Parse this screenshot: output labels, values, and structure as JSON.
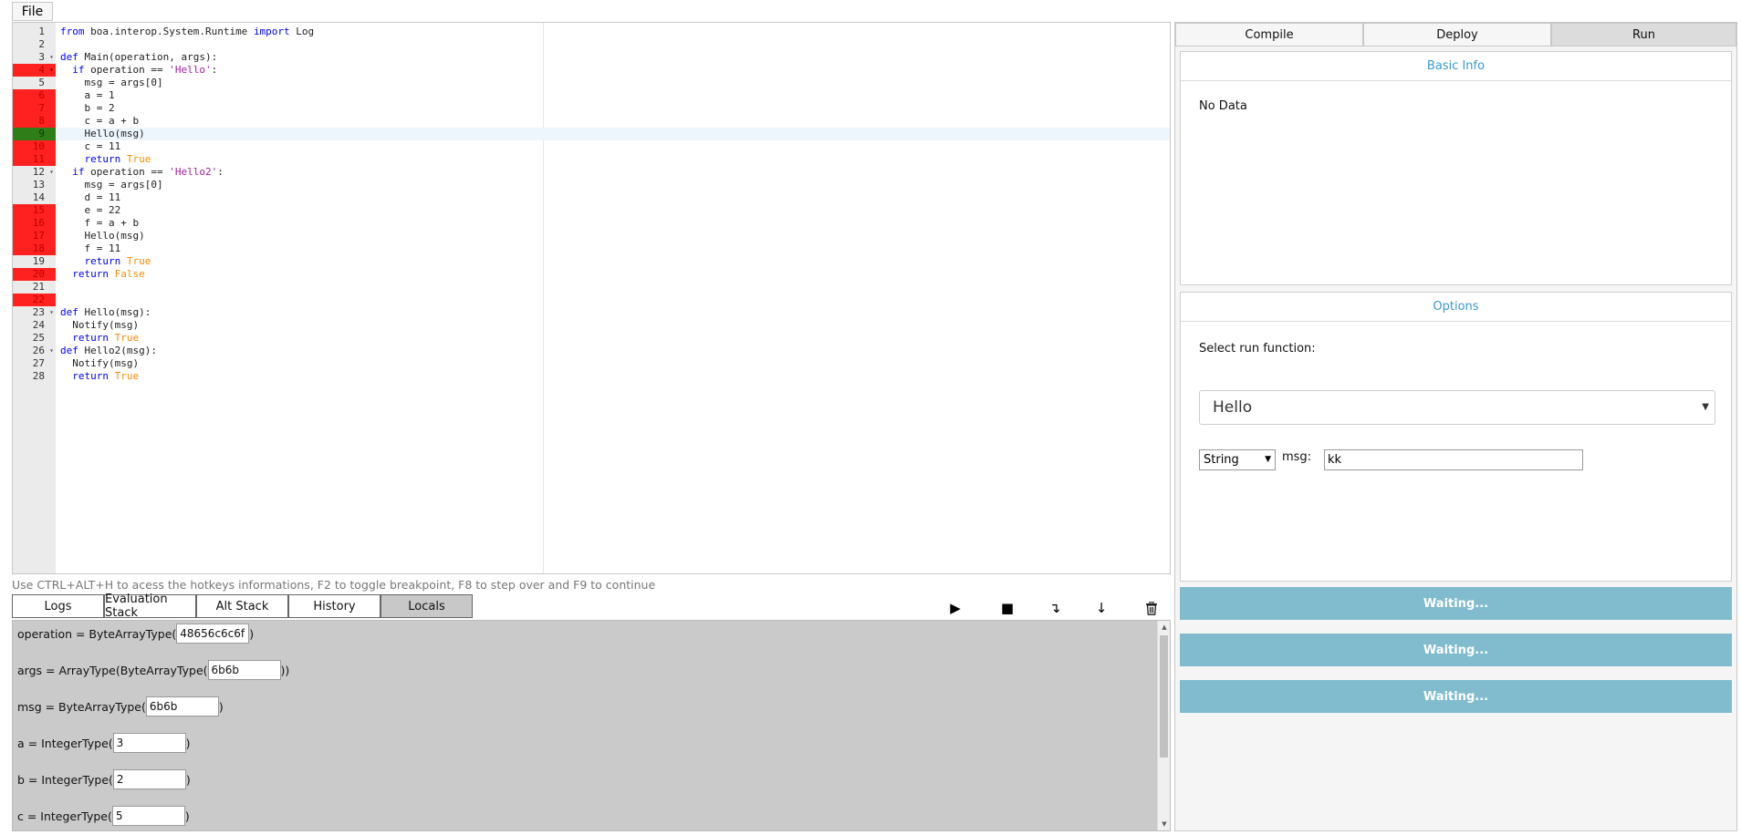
{
  "menu": {
    "file_label": "File"
  },
  "editor": {
    "lines": [
      {
        "n": "1",
        "bp": "none",
        "fold": false,
        "tokens": [
          {
            "t": "from",
            "c": "kw"
          },
          {
            "t": " boa.interop.System.Runtime ",
            "c": ""
          },
          {
            "t": "import",
            "c": "kw"
          },
          {
            "t": " Log",
            "c": ""
          }
        ]
      },
      {
        "n": "2",
        "bp": "none",
        "fold": false,
        "tokens": []
      },
      {
        "n": "3",
        "bp": "none",
        "fold": true,
        "tokens": [
          {
            "t": "def",
            "c": "kw"
          },
          {
            "t": " Main(operation, args):",
            "c": ""
          }
        ]
      },
      {
        "n": "4",
        "bp": "red",
        "fold": true,
        "tokens": [
          {
            "t": "  ",
            "c": ""
          },
          {
            "t": "if",
            "c": "kw"
          },
          {
            "t": " operation == ",
            "c": ""
          },
          {
            "t": "'Hello'",
            "c": "str"
          },
          {
            "t": ":",
            "c": ""
          }
        ]
      },
      {
        "n": "5",
        "bp": "none",
        "fold": false,
        "tokens": [
          {
            "t": "    msg = args[0]",
            "c": ""
          }
        ]
      },
      {
        "n": "6",
        "bp": "red",
        "fold": false,
        "tokens": [
          {
            "t": "    a = 1",
            "c": ""
          }
        ]
      },
      {
        "n": "7",
        "bp": "red",
        "fold": false,
        "tokens": [
          {
            "t": "    b = 2",
            "c": ""
          }
        ]
      },
      {
        "n": "8",
        "bp": "red",
        "fold": false,
        "tokens": [
          {
            "t": "    c = a + b",
            "c": ""
          }
        ]
      },
      {
        "n": "9",
        "bp": "green",
        "fold": false,
        "active": true,
        "tokens": [
          {
            "t": "    Hello(msg)",
            "c": ""
          }
        ]
      },
      {
        "n": "10",
        "bp": "red",
        "fold": false,
        "tokens": [
          {
            "t": "    c = 11",
            "c": ""
          }
        ]
      },
      {
        "n": "11",
        "bp": "red",
        "fold": false,
        "tokens": [
          {
            "t": "    ",
            "c": ""
          },
          {
            "t": "return",
            "c": "kw"
          },
          {
            "t": " ",
            "c": ""
          },
          {
            "t": "True",
            "c": "lit"
          }
        ]
      },
      {
        "n": "12",
        "bp": "none",
        "fold": true,
        "tokens": [
          {
            "t": "  ",
            "c": ""
          },
          {
            "t": "if",
            "c": "kw"
          },
          {
            "t": " operation == ",
            "c": ""
          },
          {
            "t": "'Hello2'",
            "c": "str"
          },
          {
            "t": ":",
            "c": ""
          }
        ]
      },
      {
        "n": "13",
        "bp": "none",
        "fold": false,
        "tokens": [
          {
            "t": "    msg = args[0]",
            "c": ""
          }
        ]
      },
      {
        "n": "14",
        "bp": "none",
        "fold": false,
        "tokens": [
          {
            "t": "    d = 11",
            "c": ""
          }
        ]
      },
      {
        "n": "15",
        "bp": "red",
        "fold": false,
        "tokens": [
          {
            "t": "    e = 22",
            "c": ""
          }
        ]
      },
      {
        "n": "16",
        "bp": "red",
        "fold": false,
        "tokens": [
          {
            "t": "    f = a + b",
            "c": ""
          }
        ]
      },
      {
        "n": "17",
        "bp": "red",
        "fold": false,
        "tokens": [
          {
            "t": "    Hello(msg)",
            "c": ""
          }
        ]
      },
      {
        "n": "18",
        "bp": "red",
        "fold": false,
        "tokens": [
          {
            "t": "    f = 11",
            "c": ""
          }
        ]
      },
      {
        "n": "19",
        "bp": "none",
        "fold": false,
        "tokens": [
          {
            "t": "    ",
            "c": ""
          },
          {
            "t": "return",
            "c": "kw"
          },
          {
            "t": " ",
            "c": ""
          },
          {
            "t": "True",
            "c": "lit"
          }
        ]
      },
      {
        "n": "20",
        "bp": "red",
        "fold": false,
        "tokens": [
          {
            "t": "  ",
            "c": ""
          },
          {
            "t": "return",
            "c": "kw"
          },
          {
            "t": " ",
            "c": ""
          },
          {
            "t": "False",
            "c": "lit"
          }
        ]
      },
      {
        "n": "21",
        "bp": "none",
        "fold": false,
        "tokens": []
      },
      {
        "n": "22",
        "bp": "red",
        "fold": false,
        "tokens": []
      },
      {
        "n": "23",
        "bp": "none",
        "fold": true,
        "tokens": [
          {
            "t": "def",
            "c": "kw"
          },
          {
            "t": " Hello(msg):",
            "c": ""
          }
        ]
      },
      {
        "n": "24",
        "bp": "none",
        "fold": false,
        "tokens": [
          {
            "t": "  Notify(msg)",
            "c": ""
          }
        ]
      },
      {
        "n": "25",
        "bp": "none",
        "fold": false,
        "tokens": [
          {
            "t": "  ",
            "c": ""
          },
          {
            "t": "return",
            "c": "kw"
          },
          {
            "t": " ",
            "c": ""
          },
          {
            "t": "True",
            "c": "lit"
          }
        ]
      },
      {
        "n": "26",
        "bp": "none",
        "fold": true,
        "tokens": [
          {
            "t": "def",
            "c": "kw"
          },
          {
            "t": " Hello2(msg):",
            "c": ""
          }
        ]
      },
      {
        "n": "27",
        "bp": "none",
        "fold": false,
        "tokens": [
          {
            "t": "  Notify(msg)",
            "c": ""
          }
        ]
      },
      {
        "n": "28",
        "bp": "none",
        "fold": false,
        "tokens": [
          {
            "t": "  ",
            "c": ""
          },
          {
            "t": "return",
            "c": "kw"
          },
          {
            "t": " ",
            "c": ""
          },
          {
            "t": "True",
            "c": "lit"
          }
        ]
      }
    ]
  },
  "hint_text": "Use CTRL+ALT+H to acess the hotkeys informations, F2 to toggle breakpoint, F8 to step over and F9 to continue",
  "debug": {
    "tabs": [
      "Logs",
      "Evaluation Stack",
      "Alt Stack",
      "History",
      "Locals"
    ],
    "active_tab": "Locals",
    "toolbar": {
      "run_icon": "▶",
      "stop_icon": "■",
      "step_over_icon": "↴",
      "step_into_icon": "↓",
      "clear_icon": "trash"
    },
    "locals": [
      {
        "prefix": "operation = ByteArrayType(",
        "value": "48656c6c6f",
        "suffix": ")"
      },
      {
        "prefix": "args = ArrayType(ByteArrayType(",
        "value": "6b6b",
        "suffix": "))"
      },
      {
        "prefix": "msg = ByteArrayType(",
        "value": "6b6b",
        "suffix": ")"
      },
      {
        "prefix": "a = IntegerType(",
        "value": "3",
        "suffix": ")"
      },
      {
        "prefix": "b = IntegerType(",
        "value": "2",
        "suffix": ")"
      },
      {
        "prefix": "c = IntegerType(",
        "value": "5",
        "suffix": ")"
      }
    ]
  },
  "right": {
    "tabs": [
      "Compile",
      "Deploy",
      "Run"
    ],
    "active_tab": "Run",
    "basic_info": {
      "title": "Basic Info",
      "body": "No Data"
    },
    "options": {
      "title": "Options",
      "select_label": "Select run function:",
      "selected_function": "Hello",
      "param_type": "String",
      "param_name": "msg:",
      "param_value": "kk"
    },
    "status_bars": [
      "Waiting...",
      "Waiting...",
      "Waiting..."
    ]
  },
  "colors": {
    "breakpoint": "#ff2020",
    "current_line": "#2e7d18",
    "accent": "#3a9ad0",
    "status": "#80bccd"
  }
}
